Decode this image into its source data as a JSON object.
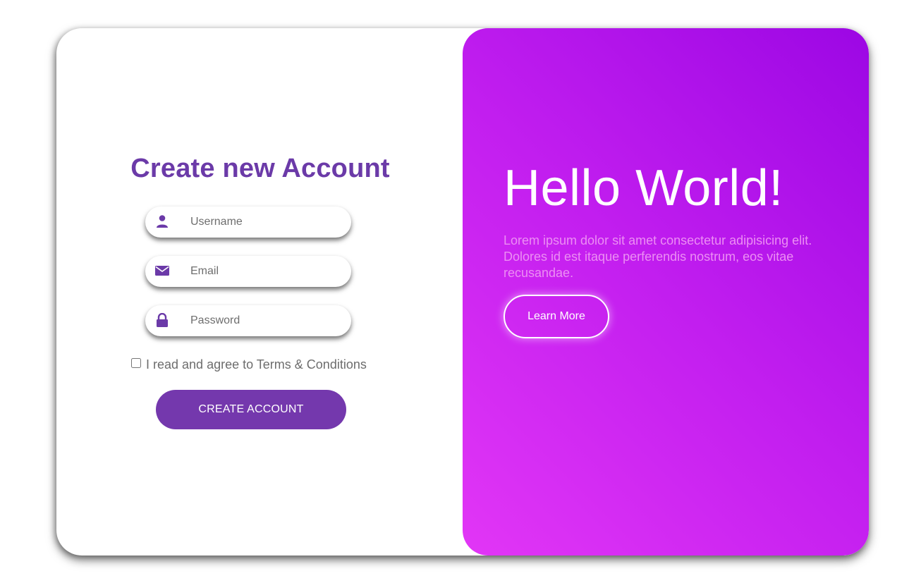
{
  "signup": {
    "title": "Create new Account",
    "username": {
      "placeholder": "Username",
      "icon": "user-icon"
    },
    "email": {
      "placeholder": "Email",
      "icon": "envelope-icon"
    },
    "password": {
      "placeholder": "Password",
      "icon": "lock-icon"
    },
    "terms_label": "I read and agree to Terms & Conditions",
    "terms_checked": false,
    "submit_label": "CREATE ACCOUNT"
  },
  "promo": {
    "heading": "Hello World!",
    "body": "Lorem ipsum dolor sit amet consectetur adipisicing elit. Dolores id est itaque perferendis nostrum, eos vitae recusandae.",
    "button_label": "Learn More"
  },
  "colors": {
    "accent": "#6b3aa8",
    "button": "#7438ad",
    "gradient_start": "#e236f6",
    "gradient_end": "#9c07e4",
    "promo_text": "#ec8ef3"
  }
}
